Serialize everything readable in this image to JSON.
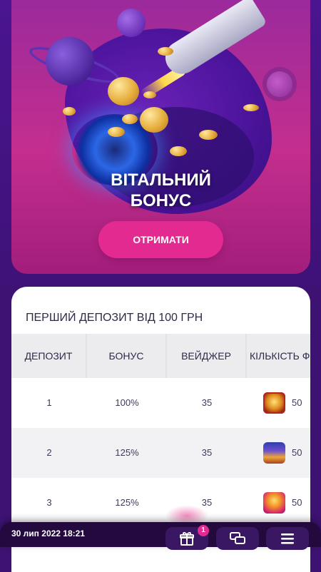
{
  "promo": {
    "title_line1": "ВІТАЛЬНИЙ",
    "title_line2": "БОНУС",
    "cta_label": "ОТРИМАТИ"
  },
  "bonus_table": {
    "heading": "ПЕРШИЙ ДЕПОЗИТ ВІД 100 ГРН",
    "columns": [
      "ДЕПОЗИТ",
      "БОНУС",
      "ВЕЙДЖЕР",
      "КІЛЬКІСТЬ Ф"
    ],
    "rows": [
      {
        "deposit": "1",
        "bonus": "100%",
        "wager": "35",
        "spins": "50",
        "game_icon": "gold-slot-icon"
      },
      {
        "deposit": "2",
        "bonus": "125%",
        "wager": "35",
        "spins": "50",
        "game_icon": "egypt-slot-icon"
      },
      {
        "deposit": "3",
        "bonus": "125%",
        "wager": "35",
        "spins": "50",
        "game_icon": "fruit-slot-icon"
      }
    ]
  },
  "bottom_bar": {
    "datetime": "30 лип 2022 18:21",
    "gift_badge": "1",
    "icons": [
      "gift-icon",
      "chat-icon",
      "menu-icon"
    ]
  },
  "colors": {
    "background": "#3d1272",
    "accent": "#e32a90",
    "promo_pink": "#c42e8e",
    "card": "#ffffff",
    "bottom_bar": "#24093f"
  }
}
